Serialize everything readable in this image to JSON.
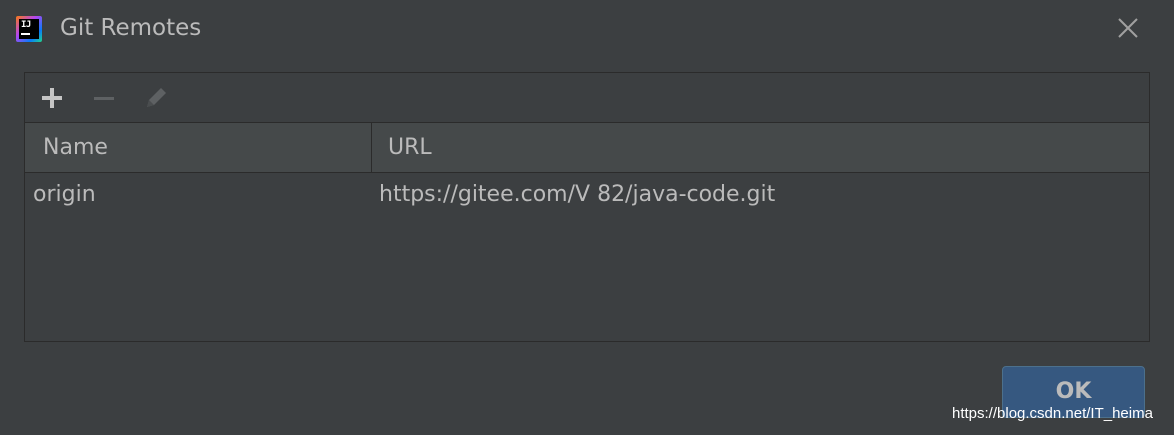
{
  "window": {
    "title": "Git Remotes",
    "app_icon": "intellij-idea-icon",
    "app_icon_text": "IJ"
  },
  "toolbar": {
    "add_icon": "plus-icon",
    "remove_icon": "minus-icon",
    "edit_icon": "pencil-icon"
  },
  "table": {
    "columns": [
      "Name",
      "URL"
    ],
    "rows": [
      {
        "name": "origin",
        "url": "https://gitee.com/V          82/java-code.git"
      }
    ]
  },
  "buttons": {
    "ok_label": "OK"
  },
  "watermark": "https://blog.csdn.net/IT_heima",
  "colors": {
    "background": "#3c3f41",
    "header": "#45494a",
    "border": "#2b2b2b",
    "text": "#bbbbbb",
    "accent": "#365880"
  }
}
